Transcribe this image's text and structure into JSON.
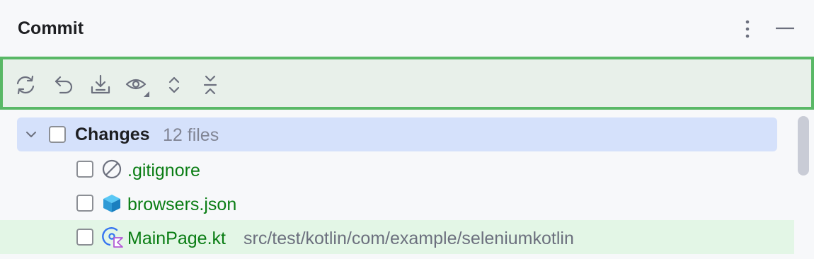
{
  "header": {
    "title": "Commit"
  },
  "toolbar": {
    "icons": [
      "refresh-icon",
      "rollback-icon",
      "shelve-icon",
      "view-options-icon",
      "expand-all-icon",
      "collapse-all-icon"
    ],
    "highlight_color": "#59b866"
  },
  "tree": {
    "group": {
      "label": "Changes",
      "count": "12 files",
      "expanded": true,
      "checked": false
    },
    "files": [
      {
        "name": ".gitignore",
        "icon": "ignored-file-icon",
        "path": "",
        "checked": false
      },
      {
        "name": "browsers.json",
        "icon": "json-file-icon",
        "path": "",
        "checked": false
      },
      {
        "name": "MainPage.kt",
        "icon": "kotlin-file-icon",
        "path": "src/test/kotlin/com/example/seleniumkotlin",
        "checked": false
      }
    ]
  },
  "colors": {
    "added_file": "#0a7d14",
    "selected_row": "#d5e1fb",
    "hover_row": "#e3f6e6"
  }
}
